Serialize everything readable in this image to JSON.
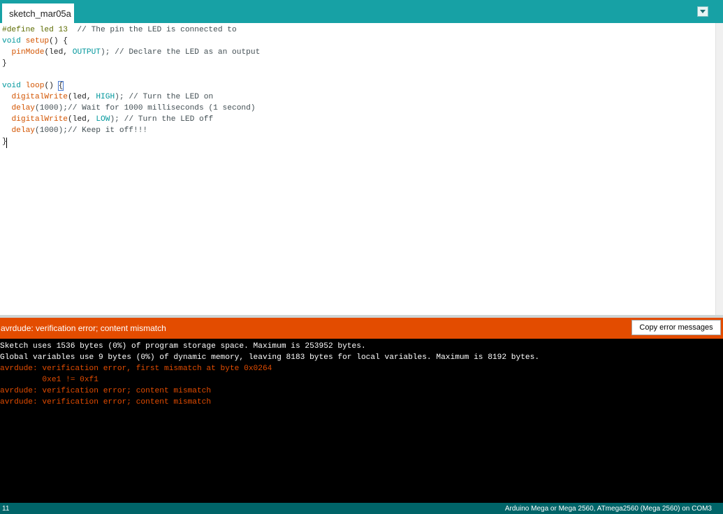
{
  "tab": {
    "label": "sketch_mar05a"
  },
  "editor": {
    "lines": [
      [
        "#define led 13",
        "  // The pin the LED is connected to"
      ],
      [
        "void",
        "setup",
        "() {"
      ],
      [
        "pinMode",
        "(led, ",
        "OUTPUT",
        "); // Declare the LED as an output"
      ],
      [
        "}"
      ],
      [
        ""
      ],
      [
        "void",
        "loop",
        "() ",
        "{"
      ],
      [
        "digitalWrite",
        "(led, ",
        "HIGH",
        "); // Turn the LED on"
      ],
      [
        "delay",
        "(1000);// Wait for 1000 milliseconds (1 second)"
      ],
      [
        "digitalWrite",
        "(led, ",
        "LOW",
        "); // Turn the LED off"
      ],
      [
        "delay",
        "(1000);// Keep it off!!!"
      ],
      [
        "}"
      ]
    ]
  },
  "status": {
    "message": "avrdude: verification error; content mismatch",
    "copy_button_label": "Copy error messages",
    "color": "#e34c00"
  },
  "console": {
    "lines": [
      {
        "text": "Sketch uses 1536 bytes (0%) of program storage space. Maximum is 253952 bytes.",
        "kind": "info"
      },
      {
        "text": "Global variables use 9 bytes (0%) of dynamic memory, leaving 8183 bytes for local variables. Maximum is 8192 bytes.",
        "kind": "info"
      },
      {
        "text": "avrdude: verification error, first mismatch at byte 0x0264",
        "kind": "error"
      },
      {
        "text": "         0xe1 != 0xf1",
        "kind": "error"
      },
      {
        "text": "avrdude: verification error; content mismatch",
        "kind": "error"
      },
      {
        "text": "avrdude: verification error; content mismatch",
        "kind": "error"
      }
    ]
  },
  "footer": {
    "line_number": "11",
    "board_info": "Arduino Mega or Mega 2560, ATmega2560 (Mega 2560) on COM3"
  },
  "colors": {
    "tab_bar": "#17a1a5",
    "footer": "#006468",
    "console_bg": "#000000",
    "error_text": "#e34c00"
  }
}
